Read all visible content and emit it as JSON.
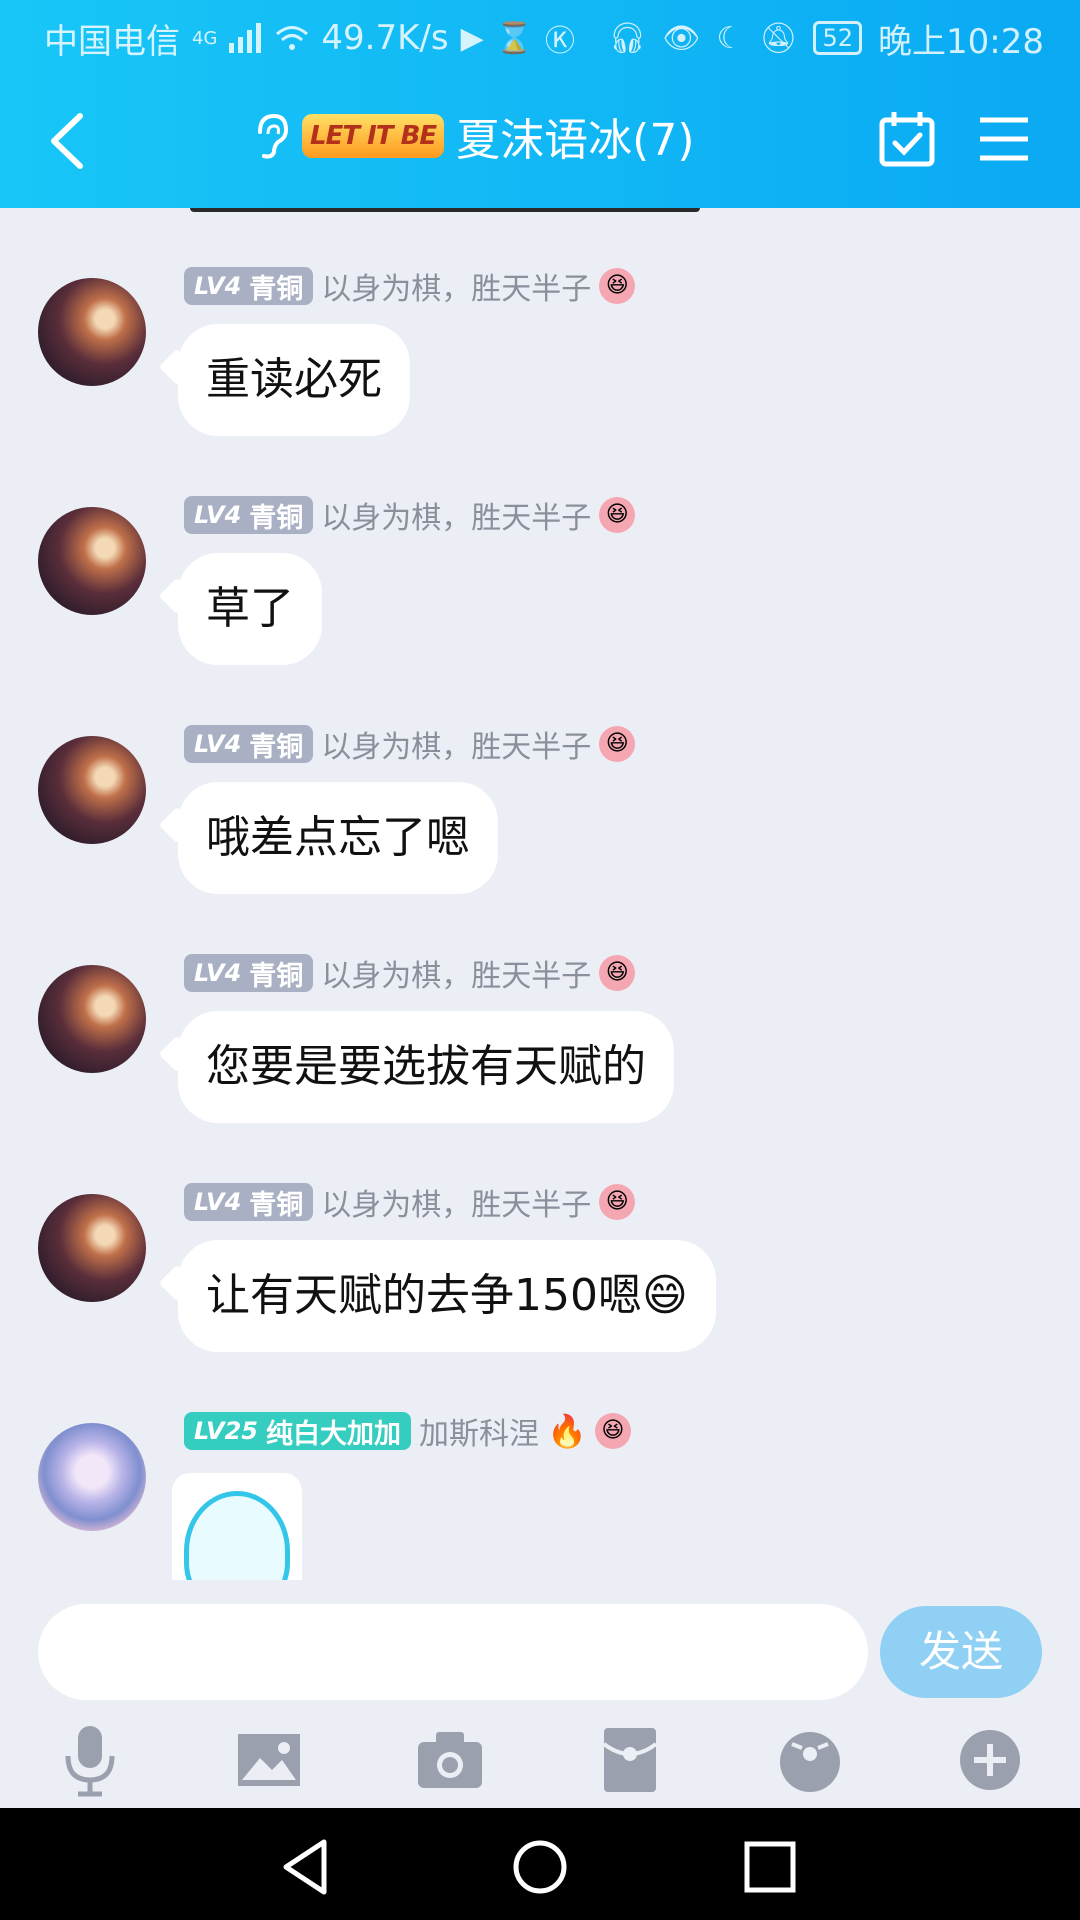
{
  "status_bar": {
    "carrier": "中国电信",
    "network": "4G",
    "speed": "49.7K/s",
    "battery": "52",
    "time": "晚上10:28"
  },
  "header": {
    "logo_text": "LET IT BE",
    "title": "夏沫语冰(7)"
  },
  "messages": [
    {
      "level": "LV4",
      "rank": "青铜",
      "nickname": "以身为棋，胜天半子",
      "text": "重读必死",
      "avatar": "avatar-anime-girl"
    },
    {
      "level": "LV4",
      "rank": "青铜",
      "nickname": "以身为棋，胜天半子",
      "text": "草了",
      "avatar": "avatar-anime-girl"
    },
    {
      "level": "LV4",
      "rank": "青铜",
      "nickname": "以身为棋，胜天半子",
      "text": "哦差点忘了嗯",
      "avatar": "avatar-anime-girl"
    },
    {
      "level": "LV4",
      "rank": "青铜",
      "nickname": "以身为棋，胜天半子",
      "text": "您要是要选拔有天赋的",
      "avatar": "avatar-anime-girl"
    },
    {
      "level": "LV4",
      "rank": "青铜",
      "nickname": "以身为棋，胜天半子",
      "text": "让有天赋的去争150嗯😄",
      "avatar": "avatar-anime-girl"
    },
    {
      "level": "LV25",
      "rank": "纯白大加加",
      "nickname": "加斯科涅",
      "text": "",
      "avatar": "avatar-blue-hair-girl",
      "sticker": "sticker-face"
    }
  ],
  "input": {
    "placeholder": "",
    "send_label": "发送"
  },
  "toolbar": [
    "microphone-icon",
    "image-icon",
    "camera-icon",
    "red-packet-icon",
    "emoji-icon",
    "plus-icon"
  ],
  "colors": {
    "header_start": "#18c6f7",
    "header_end": "#0aa9f3",
    "background": "#eceef5",
    "level_badge": "#a9b0c3",
    "level_badge_high": "#35cdbf",
    "send_button": "#8fd0f4"
  }
}
